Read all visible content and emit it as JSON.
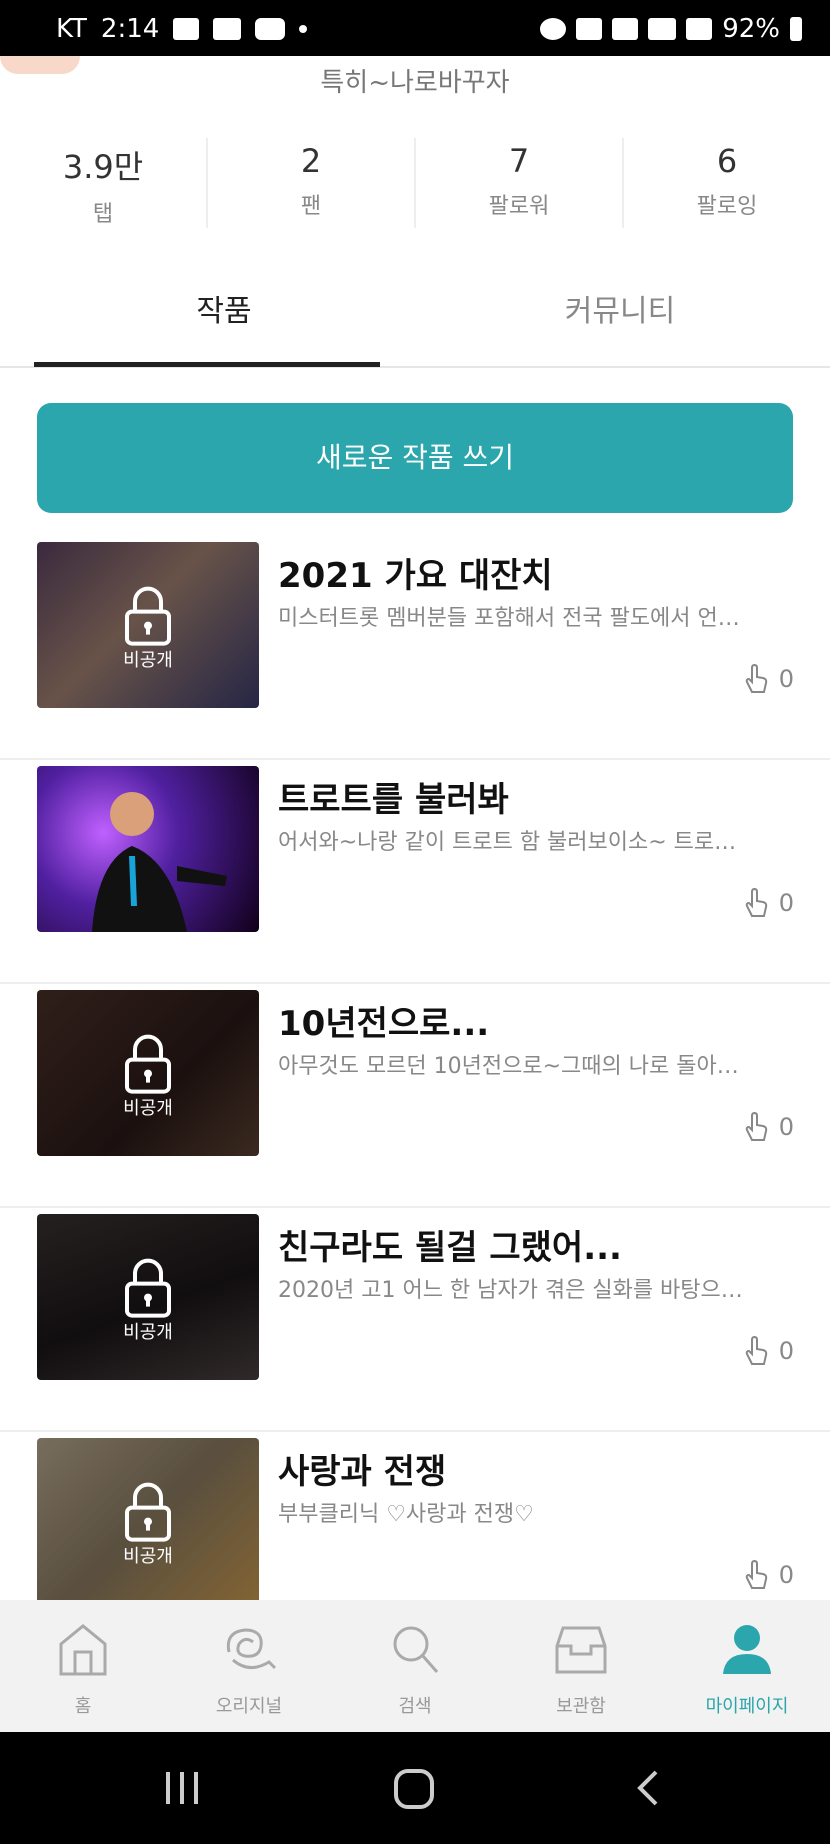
{
  "status_bar": {
    "carrier": "KT",
    "time": "2:14",
    "battery": "92%",
    "icons": [
      "image-icon",
      "cash-icon",
      "youtube-icon",
      "dot-icon",
      "alarm-icon",
      "mute-icon",
      "wifi-icon",
      "hd-icon",
      "signal-icon",
      "battery-icon"
    ]
  },
  "profile": {
    "tagline": "특히~나로바꾸자",
    "stats": [
      {
        "value": "3.9만",
        "label": "탭"
      },
      {
        "value": "2",
        "label": "팬"
      },
      {
        "value": "7",
        "label": "팔로워"
      },
      {
        "value": "6",
        "label": "팔로잉"
      }
    ]
  },
  "tabs": {
    "works": "작품",
    "community": "커뮤니티",
    "active": "works"
  },
  "new_work_button": "새로운 작품 쓰기",
  "works": [
    {
      "title": "2021 가요 대잔치",
      "description": "미스터트롯 멤버분들 포함해서 전국 팔도에서 언…",
      "likes": "0",
      "private": true,
      "private_label": "비공개",
      "thumb_color": "#6b4a5e"
    },
    {
      "title": "트로트를 불러봐",
      "description": "어서와~나랑 같이 트로트 함 불러보이소~ 트로…",
      "likes": "0",
      "private": false,
      "private_label": "",
      "thumb_color": "#5a2aa0"
    },
    {
      "title": "10년전으로...",
      "description": "아무것도 모르던 10년전으로~그때의 나로 돌아…",
      "likes": "0",
      "private": true,
      "private_label": "비공개",
      "thumb_color": "#3a2420"
    },
    {
      "title": "친구라도 될걸 그랬어...",
      "description": "2020년 고1 어느 한 남자가 겪은 실화를 바탕으…",
      "likes": "0",
      "private": true,
      "private_label": "비공개",
      "thumb_color": "#2e2a2c"
    },
    {
      "title": "사랑과 전쟁",
      "description": "부부클리닉 ♡사랑과 전쟁♡",
      "likes": "0",
      "private": true,
      "private_label": "비공개",
      "thumb_color": "#8a7a60"
    }
  ],
  "bottom_nav": [
    {
      "label": "홈",
      "icon": "home-icon"
    },
    {
      "label": "오리지널",
      "icon": "original-icon"
    },
    {
      "label": "검색",
      "icon": "search-icon"
    },
    {
      "label": "보관함",
      "icon": "archive-icon"
    },
    {
      "label": "마이페이지",
      "icon": "profile-icon",
      "active": true
    }
  ],
  "colors": {
    "accent": "#2ba6ac"
  }
}
